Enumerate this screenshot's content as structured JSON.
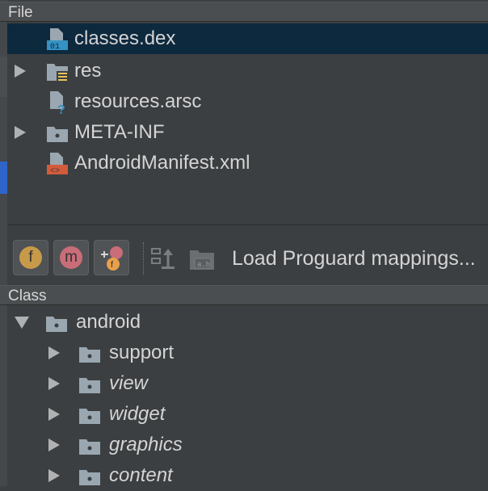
{
  "file_panel": {
    "title": "File",
    "items": [
      {
        "label": "classes.dex",
        "icon": "dex-file-icon",
        "selected": true
      },
      {
        "label": "res",
        "icon": "resource-folder-icon",
        "expandable": true
      },
      {
        "label": "resources.arsc",
        "icon": "unknown-file-icon"
      },
      {
        "label": "META-INF",
        "icon": "folder-icon",
        "expandable": true
      },
      {
        "label": "AndroidManifest.xml",
        "icon": "xml-file-icon"
      }
    ]
  },
  "toolbar": {
    "buttons": [
      {
        "name": "show-fields-button",
        "glyph": "f"
      },
      {
        "name": "show-methods-button",
        "glyph": "m"
      },
      {
        "name": "show-referenced-button",
        "glyph": "mf"
      }
    ],
    "proguard_label": "Load Proguard mappings..."
  },
  "class_panel": {
    "title": "Class",
    "items": [
      {
        "label": "android",
        "level": 0,
        "expanded": true
      },
      {
        "label": "support",
        "level": 1,
        "italic": false
      },
      {
        "label": "view",
        "level": 1,
        "italic": true
      },
      {
        "label": "widget",
        "level": 1,
        "italic": true
      },
      {
        "label": "graphics",
        "level": 1,
        "italic": true
      },
      {
        "label": "content",
        "level": 1,
        "italic": true
      }
    ]
  },
  "colors": {
    "background": "#3c3f41",
    "selection": "#0d293e",
    "field_badge": "#c79a4a",
    "method_badge": "#c96d78"
  }
}
